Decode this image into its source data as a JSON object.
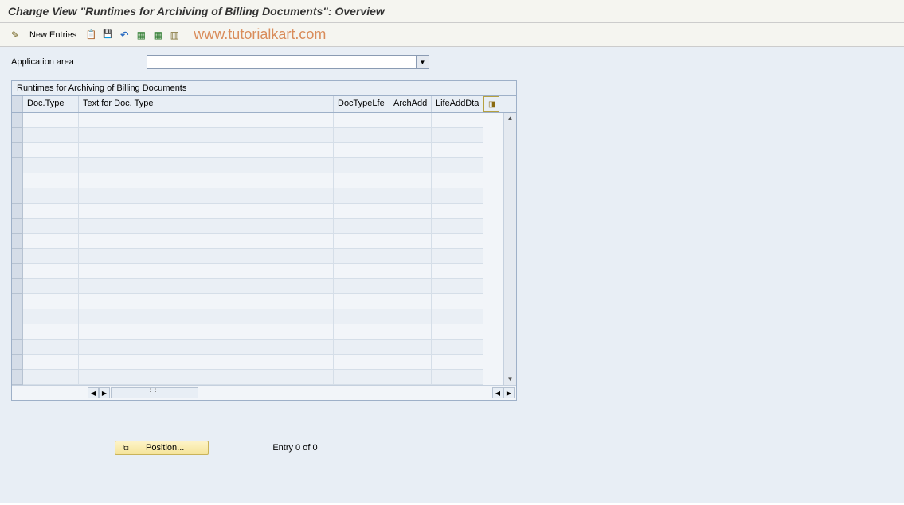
{
  "title": "Change View \"Runtimes for Archiving of Billing Documents\": Overview",
  "toolbar": {
    "new_entries": "New Entries"
  },
  "watermark": "www.tutorialkart.com",
  "field": {
    "application_area_label": "Application area",
    "application_area_value": ""
  },
  "table": {
    "title": "Runtimes for Archiving of Billing Documents",
    "columns": {
      "doctype": "Doc.Type",
      "text": "Text for Doc. Type",
      "doctypelfe": "DocTypeLfe",
      "archadd": "ArchAdd",
      "lifeadddta": "LifeAddDta"
    },
    "rows": 18
  },
  "footer": {
    "position_label": "Position...",
    "entry_text": "Entry 0 of 0"
  }
}
